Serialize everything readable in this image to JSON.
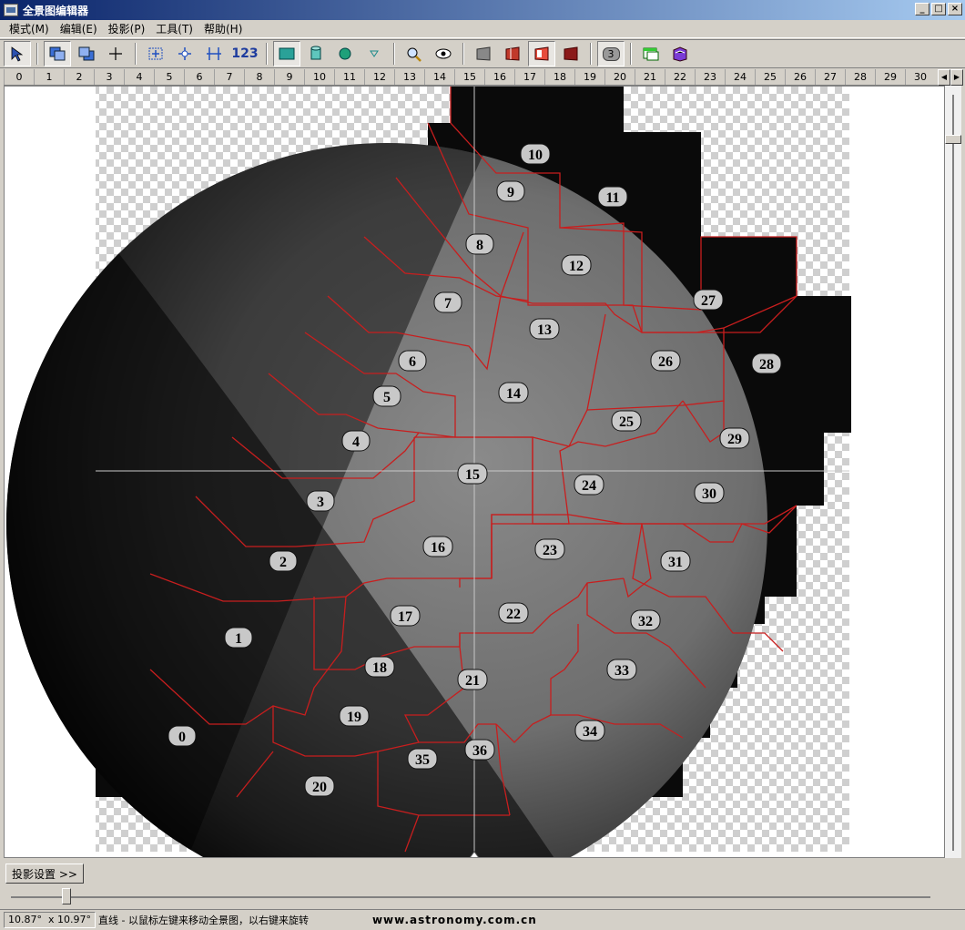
{
  "window": {
    "title": "全景图编辑器",
    "min": "_",
    "max": "□",
    "close": "×"
  },
  "menu": [
    "模式(M)",
    "编辑(E)",
    "投影(P)",
    "工具(T)",
    "帮助(H)"
  ],
  "toolbar": {
    "number_label": "123",
    "badge": "3"
  },
  "ruler": [
    "0",
    "1",
    "2",
    "3",
    "4",
    "5",
    "6",
    "7",
    "8",
    "9",
    "10",
    "11",
    "12",
    "13",
    "14",
    "15",
    "16",
    "17",
    "18",
    "19",
    "20",
    "21",
    "22",
    "23",
    "24",
    "25",
    "26",
    "27",
    "28",
    "29",
    "30"
  ],
  "moon_panels": [
    {
      "id": "0"
    },
    {
      "id": "1"
    },
    {
      "id": "2"
    },
    {
      "id": "3"
    },
    {
      "id": "4"
    },
    {
      "id": "5"
    },
    {
      "id": "6"
    },
    {
      "id": "7"
    },
    {
      "id": "8"
    },
    {
      "id": "9"
    },
    {
      "id": "10"
    },
    {
      "id": "11"
    },
    {
      "id": "12"
    },
    {
      "id": "13"
    },
    {
      "id": "14"
    },
    {
      "id": "15"
    },
    {
      "id": "16"
    },
    {
      "id": "17"
    },
    {
      "id": "18"
    },
    {
      "id": "19"
    },
    {
      "id": "20"
    },
    {
      "id": "21"
    },
    {
      "id": "22"
    },
    {
      "id": "23"
    },
    {
      "id": "24"
    },
    {
      "id": "25"
    },
    {
      "id": "26"
    },
    {
      "id": "27"
    },
    {
      "id": "28"
    },
    {
      "id": "29"
    },
    {
      "id": "30"
    },
    {
      "id": "31"
    },
    {
      "id": "32"
    },
    {
      "id": "33"
    },
    {
      "id": "34"
    },
    {
      "id": "35"
    },
    {
      "id": "36"
    }
  ],
  "projection_button": "投影设置 >>",
  "status": {
    "fov_h": "10.87°",
    "fov_v": "x 10.97°",
    "message": "直线 - 以鼠标左键来移动全景图，以右键来旋转",
    "url": "www.astronomy.com.cn"
  }
}
